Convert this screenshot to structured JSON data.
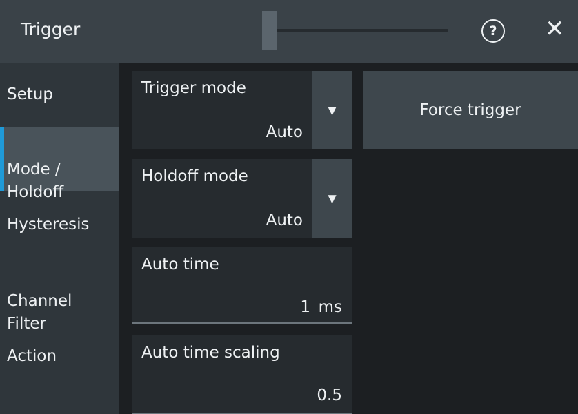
{
  "window": {
    "title": "Trigger"
  },
  "header": {
    "help_icon": "question-circle-icon",
    "help_glyph": "?",
    "close_icon": "close-icon",
    "close_glyph": "✕"
  },
  "sidebar": {
    "items": [
      {
        "label": "Setup",
        "active": false
      },
      {
        "label": "Mode /\nHoldoff",
        "active": true
      },
      {
        "label": "Hysteresis",
        "active": false
      },
      {
        "label": "Channel\nFilter",
        "active": false
      },
      {
        "label": "Action",
        "active": false
      }
    ]
  },
  "fields": {
    "trigger_mode": {
      "label": "Trigger mode",
      "value": "Auto"
    },
    "holdoff_mode": {
      "label": "Holdoff mode",
      "value": "Auto"
    },
    "auto_time": {
      "label": "Auto time",
      "value": "1",
      "unit": "ms"
    },
    "auto_time_scaling": {
      "label": "Auto time scaling",
      "value": "0.5"
    }
  },
  "dropdown_glyph": "▼",
  "force_trigger": {
    "label": "Force trigger"
  },
  "colors": {
    "accent": "#1f9ad8",
    "background": "#1c1f22",
    "titlebar": "#3a4248",
    "sidebar": "#2f363b",
    "button": "#3e474d"
  }
}
